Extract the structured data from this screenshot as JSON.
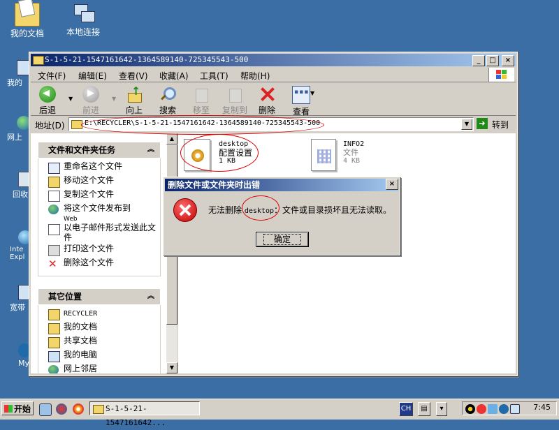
{
  "desktop": {
    "icons": [
      {
        "label": "我的文档"
      },
      {
        "label": "本地连接"
      },
      {
        "label": "我的"
      },
      {
        "label": "网上"
      },
      {
        "label": "回收"
      },
      {
        "label": "Inte Expl"
      },
      {
        "label": "宽带"
      },
      {
        "label": "My"
      }
    ]
  },
  "window": {
    "title": "S-1-5-21-1547161642-1364589140-725345543-500",
    "controls": {
      "minimize": "_",
      "maximize": "□",
      "close": "×"
    },
    "menu": [
      "文件(F)",
      "编辑(E)",
      "查看(V)",
      "收藏(A)",
      "工具(T)",
      "帮助(H)"
    ],
    "toolbar": {
      "back": "后退",
      "forward": "前进",
      "up": "向上",
      "search": "搜索",
      "move_to": "移至",
      "copy_to": "复制到",
      "delete": "删除",
      "view": "查看"
    },
    "address": {
      "label": "地址(D)",
      "value": "E:\\RECYCLER\\S-1-5-21-1547161642-1364589140-725345543-500",
      "go": "转到"
    },
    "file_tasks": {
      "title": "文件和文件夹任务",
      "items": [
        {
          "label": "重命名这个文件"
        },
        {
          "label": "移动这个文件"
        },
        {
          "label": "复制这个文件"
        },
        {
          "label": "将这个文件发布到",
          "sub": "Web"
        },
        {
          "label": "以电子邮件形式发送此文件"
        },
        {
          "label": "打印这个文件"
        },
        {
          "label": "删除这个文件"
        }
      ]
    },
    "other_places": {
      "title": "其它位置",
      "items": [
        {
          "label": "RECYCLER"
        },
        {
          "label": "我的文档"
        },
        {
          "label": "共享文档"
        },
        {
          "label": "我的电脑"
        },
        {
          "label": "网上邻居"
        }
      ]
    },
    "files": [
      {
        "name": "desktop",
        "type": "配置设置",
        "size": "1 KB"
      },
      {
        "name": "INFO2",
        "type": "文件",
        "size": "4 KB"
      }
    ]
  },
  "dialog": {
    "title": "删除文件或文件夹时出错",
    "close": "×",
    "message_prefix": "无法删除",
    "message_file": "desktop",
    "message_suffix": "：文件或目录损坏且无法读取。",
    "ok": "确定"
  },
  "taskbar": {
    "start": "开始",
    "task": "S-1-5-21-1547161642...",
    "ime": "CH",
    "clock": "7:45"
  },
  "colors": {
    "desktop_bg": "#3a6ea5",
    "title_active": "#0a246a",
    "annotation_red": "#dd0000"
  }
}
